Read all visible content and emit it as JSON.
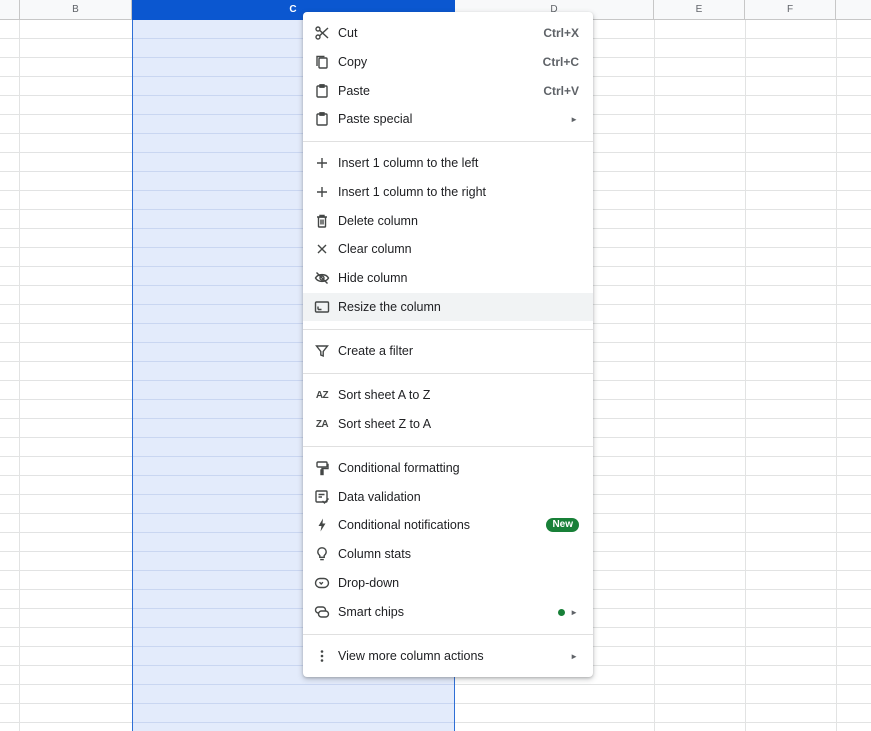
{
  "columns": [
    "B",
    "C",
    "D",
    "E",
    "F"
  ],
  "colors": {
    "selected_header": "#0b57d0",
    "selected_fill": "#e3ebfb",
    "badge": "#188038"
  },
  "menu": {
    "cut": {
      "label": "Cut",
      "shortcut": "Ctrl+X",
      "icon": "scissors-icon"
    },
    "copy": {
      "label": "Copy",
      "shortcut": "Ctrl+C",
      "icon": "copy-icon"
    },
    "paste": {
      "label": "Paste",
      "shortcut": "Ctrl+V",
      "icon": "clipboard-icon"
    },
    "paste_special": {
      "label": "Paste special",
      "icon": "clipboard-icon"
    },
    "insert_left": {
      "label": "Insert 1 column to the left",
      "icon": "plus-icon"
    },
    "insert_right": {
      "label": "Insert 1 column to the right",
      "icon": "plus-icon"
    },
    "delete_column": {
      "label": "Delete column",
      "icon": "trash-icon"
    },
    "clear_column": {
      "label": "Clear column",
      "icon": "close-icon"
    },
    "hide_column": {
      "label": "Hide column",
      "icon": "eye-off-icon"
    },
    "resize_column": {
      "label": "Resize the column",
      "icon": "resize-icon"
    },
    "create_filter": {
      "label": "Create a filter",
      "icon": "filter-icon"
    },
    "sort_az": {
      "label": "Sort sheet A to Z",
      "icon": "sort-az-icon",
      "glyph": "AZ"
    },
    "sort_za": {
      "label": "Sort sheet Z to A",
      "icon": "sort-za-icon",
      "glyph": "ZA"
    },
    "conditional_formatting": {
      "label": "Conditional formatting",
      "icon": "paint-roller-icon"
    },
    "data_validation": {
      "label": "Data validation",
      "icon": "checklist-icon"
    },
    "conditional_notifications": {
      "label": "Conditional notifications",
      "badge": "New",
      "icon": "bolt-icon"
    },
    "column_stats": {
      "label": "Column stats",
      "icon": "lightbulb-icon"
    },
    "dropdown": {
      "label": "Drop-down",
      "icon": "dropdown-chip-icon"
    },
    "smart_chips": {
      "label": "Smart chips",
      "icon": "chips-icon"
    },
    "more_actions": {
      "label": "View more column actions",
      "icon": "more-vert-icon"
    },
    "submenu_arrow": "►"
  }
}
